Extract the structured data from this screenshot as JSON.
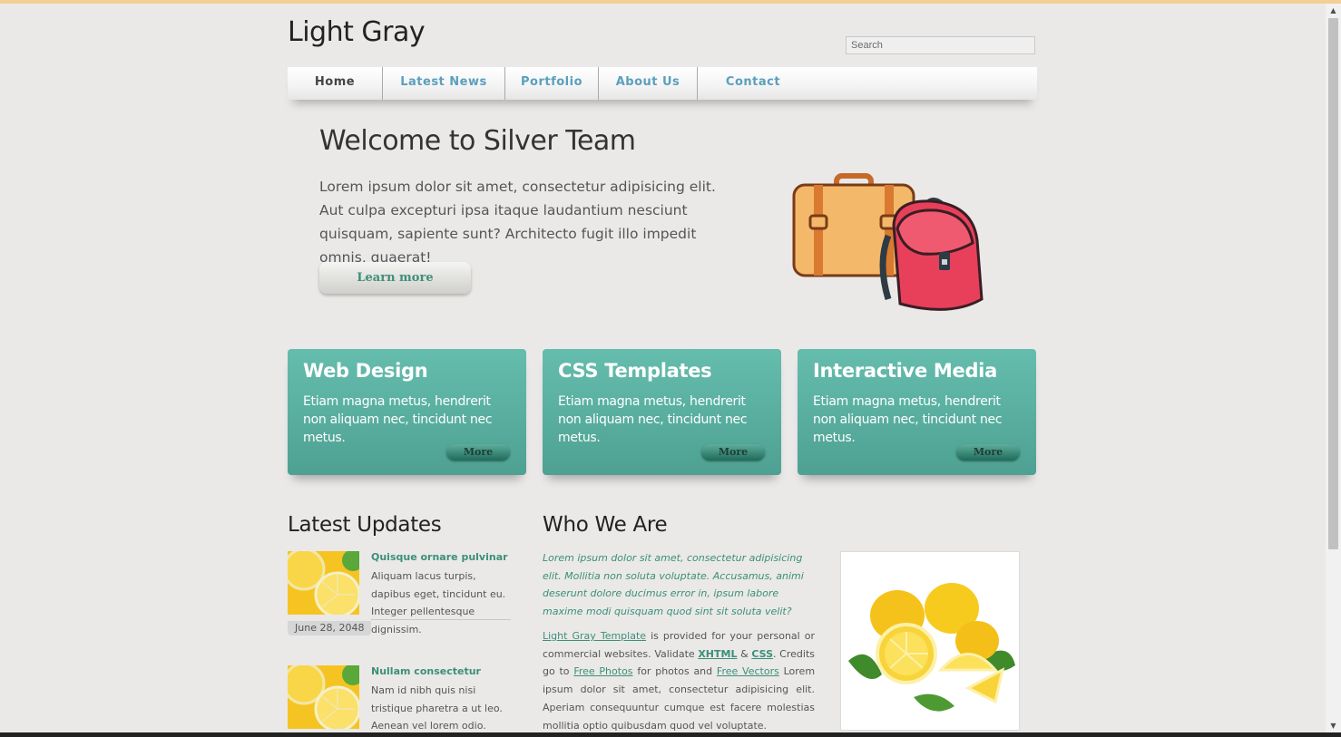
{
  "site": {
    "title": "Light Gray"
  },
  "search": {
    "placeholder": "Search"
  },
  "nav": {
    "items": [
      {
        "label": "Home"
      },
      {
        "label": "Latest News"
      },
      {
        "label": "Portfolio"
      },
      {
        "label": "About Us"
      },
      {
        "label": "Contact"
      }
    ]
  },
  "welcome": {
    "title": "Welcome to Silver Team",
    "text": "Lorem ipsum dolor sit amet, consectetur adipisicing elit. Aut culpa excepturi ipsa itaque laudantium nesciunt quisquam, sapiente sunt? Architecto fugit illo impedit omnis, quaerat!",
    "button": "Learn more",
    "illustration": "suitcase-and-backpack-icon"
  },
  "features": [
    {
      "title": "Web Design",
      "text": "Etiam magna metus, hendrerit non aliquam nec, tincidunt nec metus.",
      "button": "More"
    },
    {
      "title": "CSS Templates",
      "text": "Etiam magna metus, hendrerit non aliquam nec, tincidunt nec metus.",
      "button": "More"
    },
    {
      "title": "Interactive Media",
      "text": "Etiam magna metus, hendrerit non aliquam nec, tincidunt nec metus.",
      "button": "More"
    }
  ],
  "updates": {
    "title": "Latest Updates",
    "items": [
      {
        "heading": "Quisque ornare pulvinar",
        "text": "Aliquam lacus turpis, dapibus eget, tincidunt eu. Integer pellentesque dignissim.",
        "date": "June 28, 2048"
      },
      {
        "heading": "Nullam consectetur",
        "text": "Nam id nibh quis nisi tristique pharetra a ut leo. Aenean vel lorem odio."
      }
    ]
  },
  "who": {
    "title": "Who We Are",
    "intro": "Lorem ipsum dolor sit amet, consectetur adipisicing elit. Mollitia non soluta voluptate. Accusamus, animi deserunt dolore ducimus error in, ipsum labore maxime modi quisquam quod sint sit soluta velit?",
    "body": {
      "link_template": "Light Gray Template",
      "t1": " is provided for your personal or commercial websites. Validate ",
      "link_xhtml": "XHTML",
      "t2": " & ",
      "link_css": "CSS",
      "t3": ". Credits go to ",
      "link_photos": "Free Photos",
      "t4": " for photos and ",
      "link_vectors": "Free Vectors",
      "t5": " Lorem ipsum dolor sit amet, consectetur adipisicing elit. Aperiam consequuntur cumque est facere molestias mollitia optio quibusdam quod vel voluptate."
    }
  },
  "colors": {
    "background": "#eae9e8",
    "accent_teal": "#65bdae",
    "link_teal": "#3c8f79",
    "nav_link": "#5a9fbd"
  }
}
